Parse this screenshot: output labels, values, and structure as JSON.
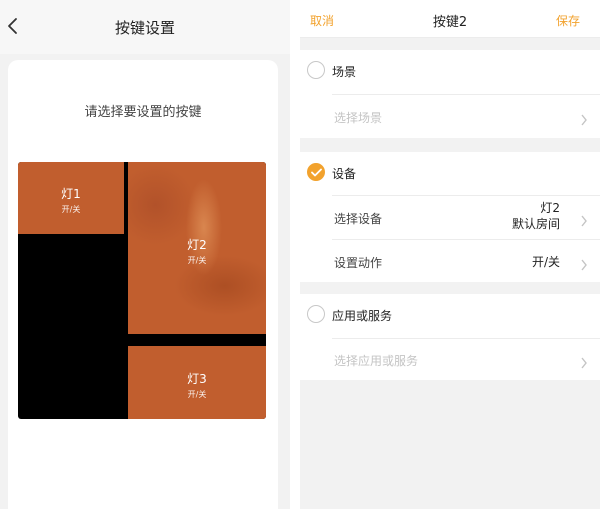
{
  "left_screen": {
    "title": "按键设置",
    "prompt": "请选择要设置的按键",
    "keys": [
      {
        "name": "灯1",
        "action": "开/关"
      },
      {
        "name": "灯2",
        "action": "开/关"
      },
      {
        "name": "灯3",
        "action": "开/关"
      }
    ]
  },
  "right_screen": {
    "header": {
      "cancel": "取消",
      "title": "按键2",
      "save": "保存"
    },
    "scene": {
      "title": "场景",
      "selected": false,
      "row_label": "选择场景"
    },
    "device": {
      "title": "设备",
      "selected": true,
      "select_label": "选择设备",
      "device_name": "灯2",
      "device_room": "默认房间",
      "action_label": "设置动作",
      "action_value": "开/关"
    },
    "app": {
      "title": "应用或服务",
      "selected": false,
      "row_label": "选择应用或服务"
    }
  },
  "colors": {
    "accent": "#f2a22d",
    "key": "#c15e2e",
    "pad": "#000000"
  }
}
